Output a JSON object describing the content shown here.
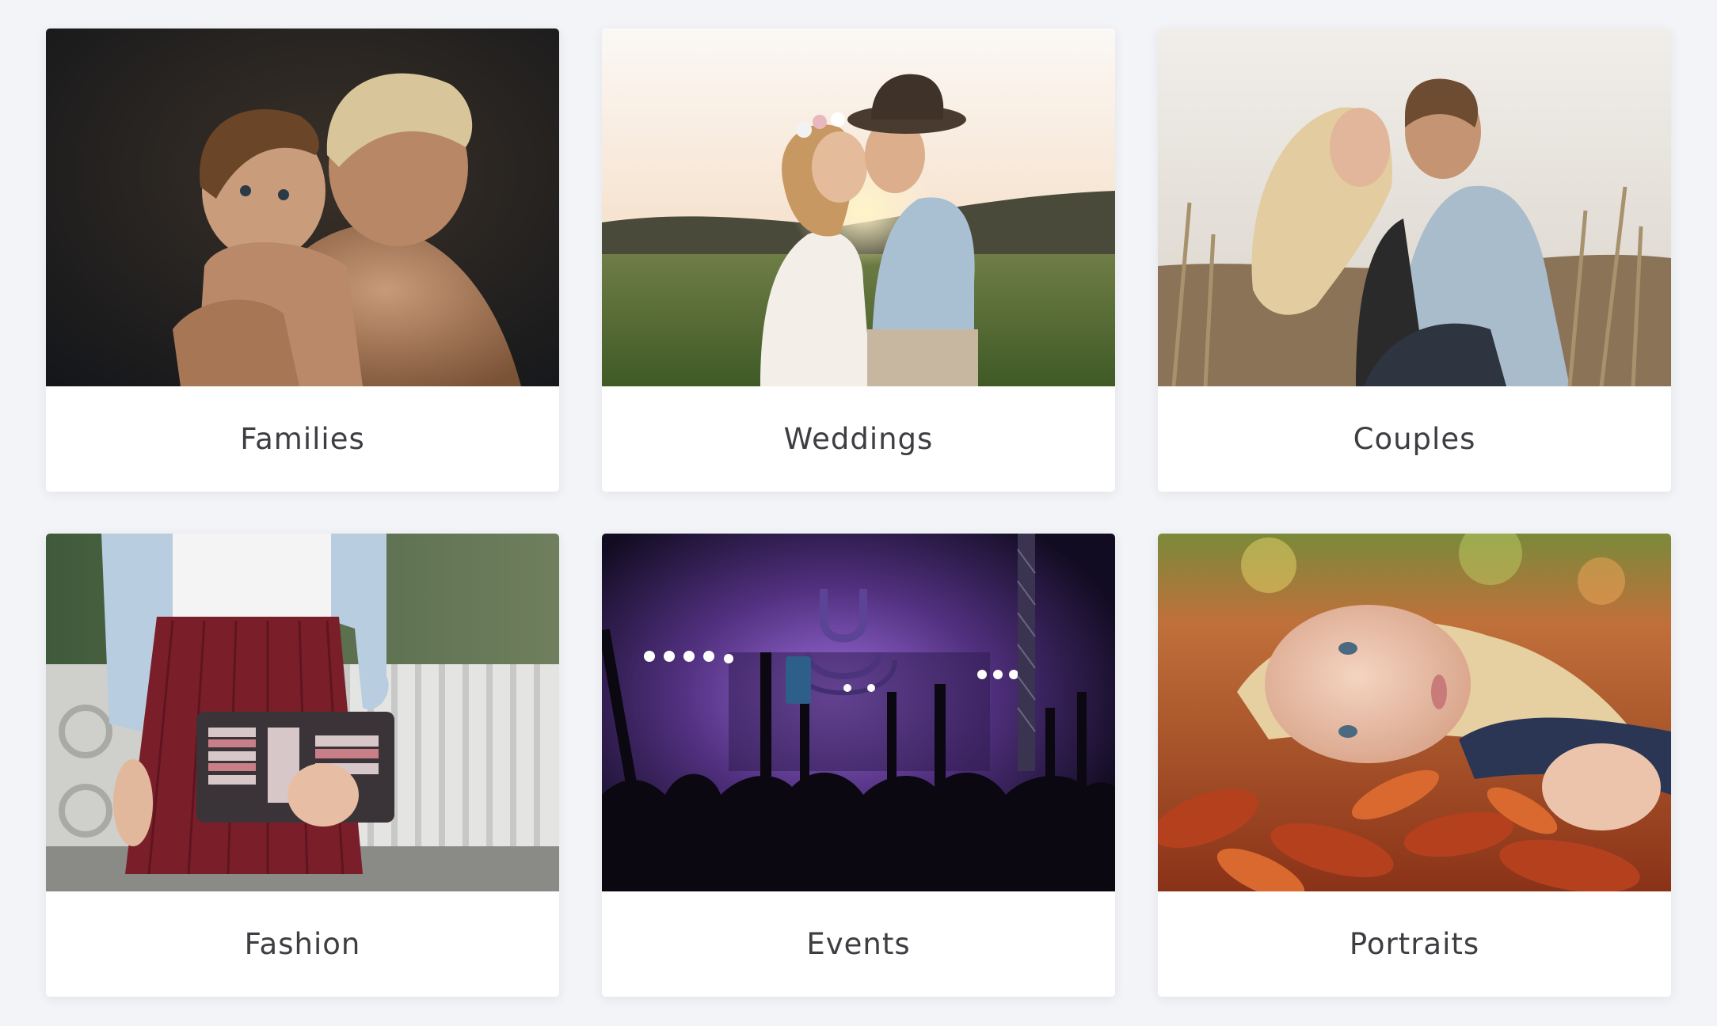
{
  "categories": [
    {
      "label": "Families"
    },
    {
      "label": "Weddings"
    },
    {
      "label": "Couples"
    },
    {
      "label": "Fashion"
    },
    {
      "label": "Events"
    },
    {
      "label": "Portraits"
    }
  ]
}
